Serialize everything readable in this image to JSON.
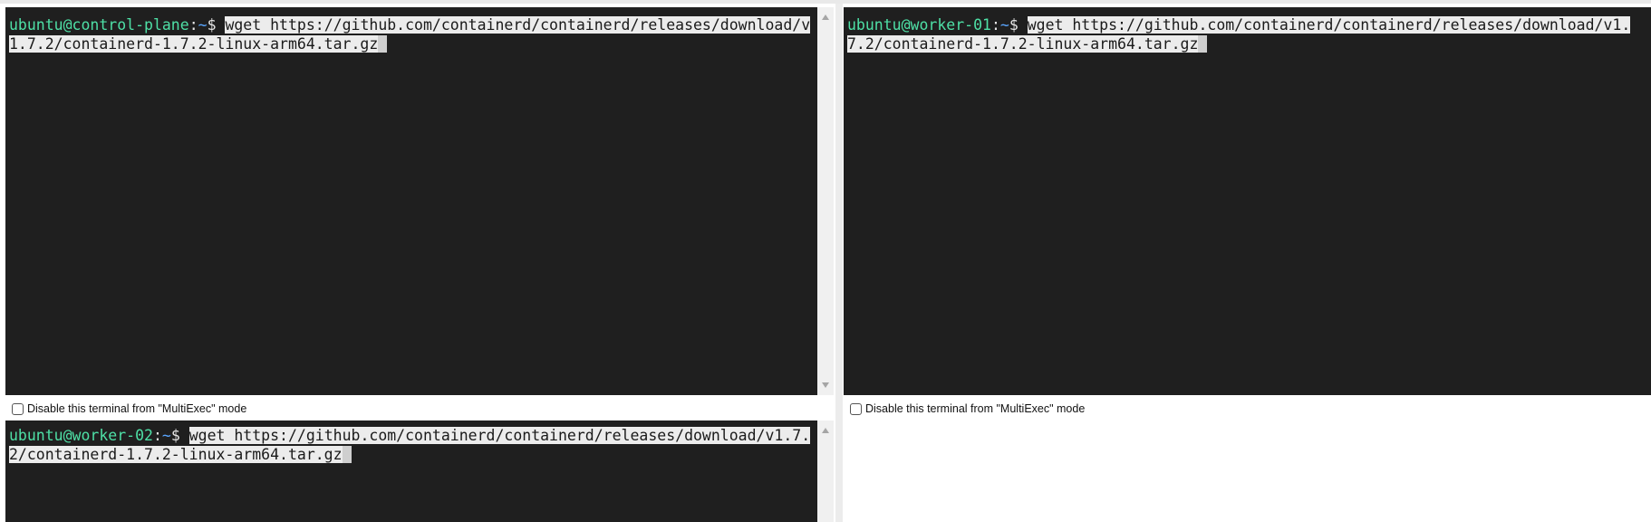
{
  "disable_option_label": "Disable this terminal from \"MultiExec\" mode",
  "panes": [
    {
      "id": "control-plane",
      "prompt_user_host": "ubuntu@control-plane",
      "prompt_sep": ":",
      "prompt_path": "~",
      "prompt_symbol": "$ ",
      "command": "wget https://github.com/containerd/containerd/releases/download/v1.7.2/containerd-1.7.2-linux-arm64.tar.gz"
    },
    {
      "id": "worker-01",
      "prompt_user_host": "ubuntu@worker-01",
      "prompt_sep": ":",
      "prompt_path": "~",
      "prompt_symbol": "$ ",
      "command": "wget https://github.com/containerd/containerd/releases/download/v1.7.2/containerd-1.7.2-linux-arm64.tar.gz"
    },
    {
      "id": "worker-02",
      "prompt_user_host": "ubuntu@worker-02",
      "prompt_sep": ":",
      "prompt_path": "~",
      "prompt_symbol": "$ ",
      "command": "wget https://github.com/containerd/containerd/releases/download/v1.7.2/containerd-1.7.2-linux-arm64.tar.gz"
    }
  ],
  "colors": {
    "terminal_bg": "#1f1f1f",
    "prompt_user": "#4ee0a6",
    "prompt_path": "#5aa6ff",
    "selection_bg": "#ececec"
  }
}
